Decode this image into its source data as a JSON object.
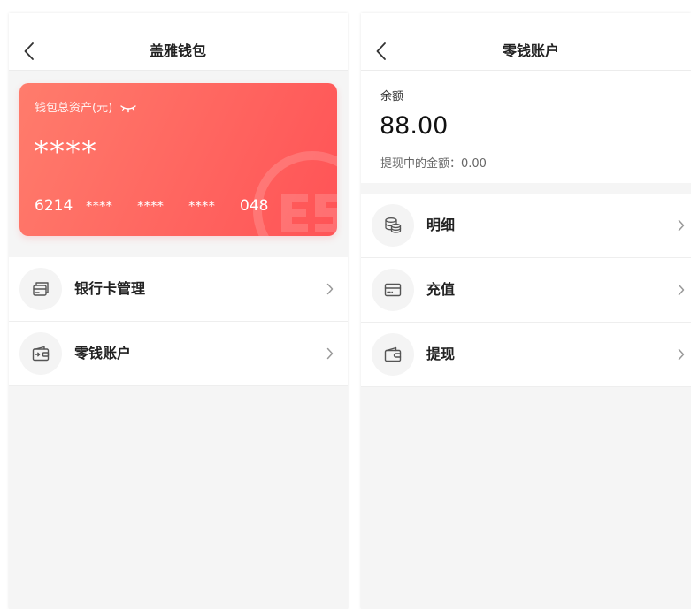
{
  "wallet_screen": {
    "title": "盖雅钱包",
    "back_icon": "back-arrow-icon",
    "asset_card": {
      "label": "钱包总资产(元)",
      "label_icon": "eye-closed-icon",
      "amount": "****",
      "card_number": [
        "6214",
        "****",
        "****",
        "****",
        "048"
      ],
      "watermark_icon": "logo-watermark-icon"
    },
    "menu": [
      {
        "label": "银行卡管理",
        "icon": "bank-card-icon",
        "chevron": "chevron-right-icon"
      },
      {
        "label": "零钱账户",
        "icon": "wallet-icon",
        "chevron": "chevron-right-icon"
      }
    ]
  },
  "change_account_screen": {
    "title": "零钱账户",
    "back_icon": "back-arrow-icon",
    "balance": {
      "label": "余额",
      "amount": "88.00",
      "pending_text": "提现中的金额：0.00"
    },
    "menu": [
      {
        "label": "明细",
        "icon": "coins-icon",
        "chevron": "chevron-right-icon"
      },
      {
        "label": "充值",
        "icon": "card-icon",
        "chevron": "chevron-right-icon"
      },
      {
        "label": "提现",
        "icon": "wallet-icon",
        "chevron": "chevron-right-icon"
      }
    ]
  },
  "colors": {
    "card_gradient_start": "#ff7c6c",
    "card_gradient_end": "#ff5356",
    "page_background": "#f5f5f5",
    "surface": "#ffffff",
    "text_primary": "#222222",
    "text_secondary": "#666666",
    "chevron": "#999999"
  }
}
